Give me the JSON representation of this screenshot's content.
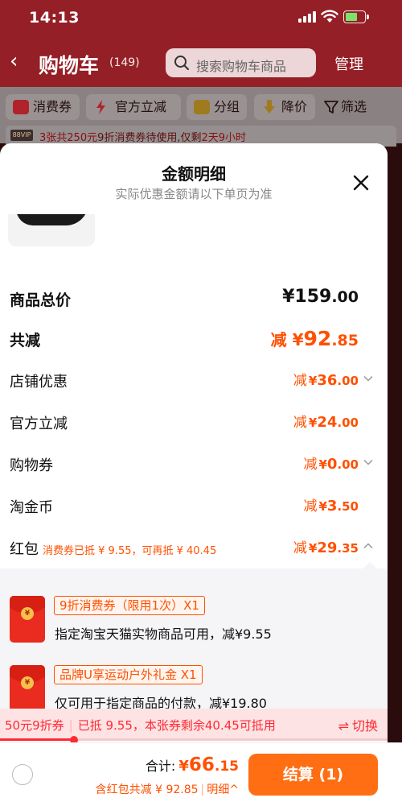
{
  "status_bar": {
    "time": "14:13"
  },
  "header": {
    "title": "购物车",
    "count": "(149)",
    "search_placeholder": "搜索购物车商品",
    "manage": "管理"
  },
  "filters": [
    {
      "label": "消费券",
      "icon": "coupon-icon"
    },
    {
      "label": "官方立减",
      "icon": "lightning-icon"
    },
    {
      "label": "分组",
      "icon": "folder-icon"
    },
    {
      "label": "降价",
      "icon": "down-arrow-icon"
    },
    {
      "label": "筛选",
      "icon": "filter-icon"
    }
  ],
  "banner": {
    "vip": "88VIP",
    "part1": "3张共",
    "part2": "250元",
    "part3": "9折消费券待使用,仅剩",
    "part4": "2天9小时"
  },
  "sheet": {
    "title": "金额明细",
    "subtitle": "实际优惠金额请以下单页为准",
    "rows": {
      "total": {
        "label": "商品总价",
        "currency": "¥",
        "int": "159",
        "dec": ".00"
      },
      "save": {
        "label": "共减",
        "prefix": "减",
        "currency": "¥",
        "int": "92",
        "dec": ".85"
      },
      "shop": {
        "label": "店铺优惠",
        "prefix": "减",
        "currency": "¥",
        "int": "36",
        "dec": ".00"
      },
      "official": {
        "label": "官方立减",
        "prefix": "减",
        "currency": "¥",
        "int": "24",
        "dec": ".00"
      },
      "voucher": {
        "label": "购物券",
        "prefix": "减",
        "currency": "¥",
        "int": "0",
        "dec": ".00"
      },
      "coin": {
        "label": "淘金币",
        "prefix": "减",
        "currency": "¥",
        "int": "3",
        "dec": ".50"
      },
      "hongbao": {
        "label": "红包",
        "note": "消费券已抵 ¥ 9.55，可再抵 ¥ 40.45",
        "prefix": "减",
        "currency": "¥",
        "int": "29",
        "dec": ".35"
      }
    },
    "coupons": [
      {
        "tag": "9折消费券（限用1次）X1",
        "desc": "指定淘宝天猫实物商品可用，减¥9.55"
      },
      {
        "tag": "品牌U享运动户外礼金 X1",
        "desc": "仅可用于指定商品的付款，减¥19.80"
      }
    ],
    "strip": {
      "coupon_name": "50元9折券",
      "used": "已抵 9.55，本张券剩余40.45可抵用",
      "switch_label": "切换",
      "progress": 0.19
    }
  },
  "bottom_bar": {
    "total_label": "合计:",
    "currency": "¥",
    "amount_int": "66",
    "amount_dec": ".15",
    "detail_savings": "含红包共减 ¥ 92.85",
    "detail_link": "明细",
    "checkout_label": "结算 (1)"
  },
  "colors": {
    "accent": "#ff5000",
    "checkout": "#ff6e13",
    "strip_text": "#ff2a35"
  }
}
